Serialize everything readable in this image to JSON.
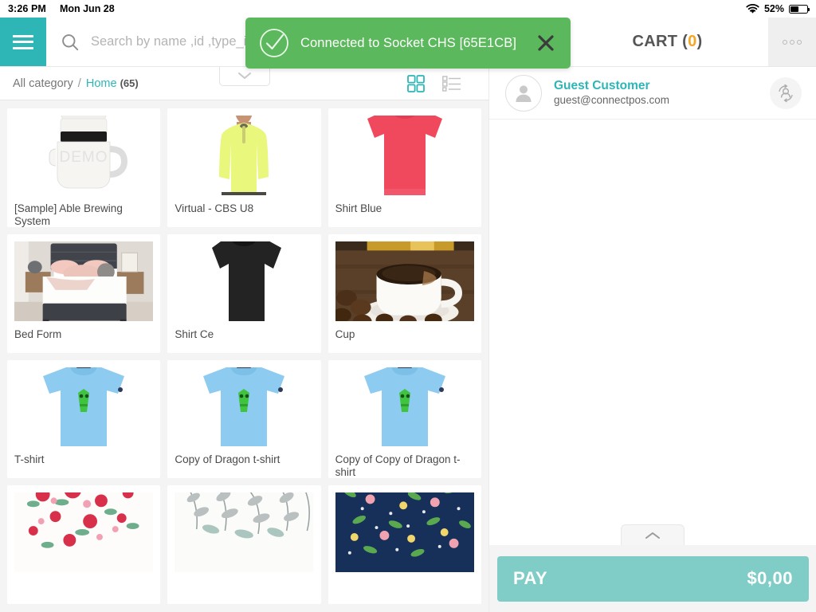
{
  "statusbar": {
    "time": "3:26 PM",
    "date": "Mon Jun 28",
    "battery_percent": "52%",
    "wifi_icon": "wifi-icon",
    "battery_icon": "battery-icon"
  },
  "appbar": {
    "menu_icon": "hamburger-menu-icon",
    "search_icon": "search-icon",
    "search_value": "",
    "search_placeholder": "Search by name ,id ,type_id ,sku",
    "cart_label": "CART",
    "cart_open_paren": "(",
    "cart_count": "0",
    "cart_close_paren": ")",
    "more_icon": "more-options-icon"
  },
  "toast": {
    "message": "Connected to Socket CHS [65E1CB]",
    "check_icon": "check-circle-icon",
    "close_icon": "close-icon",
    "background": "#5cb85c"
  },
  "breadcrumb": {
    "root": "All category",
    "separator": "/",
    "current": "Home",
    "count": "(65)",
    "dropdown_icon": "chevron-down-icon"
  },
  "view_toggle": {
    "grid_icon": "grid-view-icon",
    "list_icon": "list-view-icon",
    "active": "grid",
    "active_color": "#2eb6b6",
    "inactive_color": "#c4c4c4"
  },
  "customer": {
    "avatar_icon": "user-avatar-icon",
    "name": "Guest Customer",
    "email": "guest@connectpos.com",
    "switch_icon": "switch-customer-icon"
  },
  "cart": {
    "drawer_handle_icon": "chevron-up-icon",
    "pay_label": "PAY",
    "pay_amount": "$0,00",
    "pay_color": "#7fcdc6"
  },
  "products": [
    {
      "name": "[Sample] Able Brewing System",
      "image": "brewing-system-image"
    },
    {
      "name": "Virtual - CBS U8",
      "image": "yellow-jacket-model-image"
    },
    {
      "name": "Shirt Blue",
      "image": "red-tshirt-image"
    },
    {
      "name": "Bed Form",
      "image": "bedroom-bed-image"
    },
    {
      "name": "Shirt Ce",
      "image": "black-tshirt-image"
    },
    {
      "name": "Cup",
      "image": "coffee-cup-image"
    },
    {
      "name": "T-shirt",
      "image": "blue-dragon-tshirt-image"
    },
    {
      "name": "Copy of Dragon t-shirt",
      "image": "blue-dragon-tshirt-image"
    },
    {
      "name": "Copy of Copy of Dragon t-shirt",
      "image": "blue-dragon-tshirt-image"
    },
    {
      "name": "",
      "image": "red-floral-pattern-image"
    },
    {
      "name": "",
      "image": "gray-leaf-pattern-image"
    },
    {
      "name": "",
      "image": "navy-floral-pattern-image"
    }
  ],
  "theme": {
    "teal": "#2eb6b6",
    "orange": "#f5a623",
    "green": "#5cb85c"
  }
}
